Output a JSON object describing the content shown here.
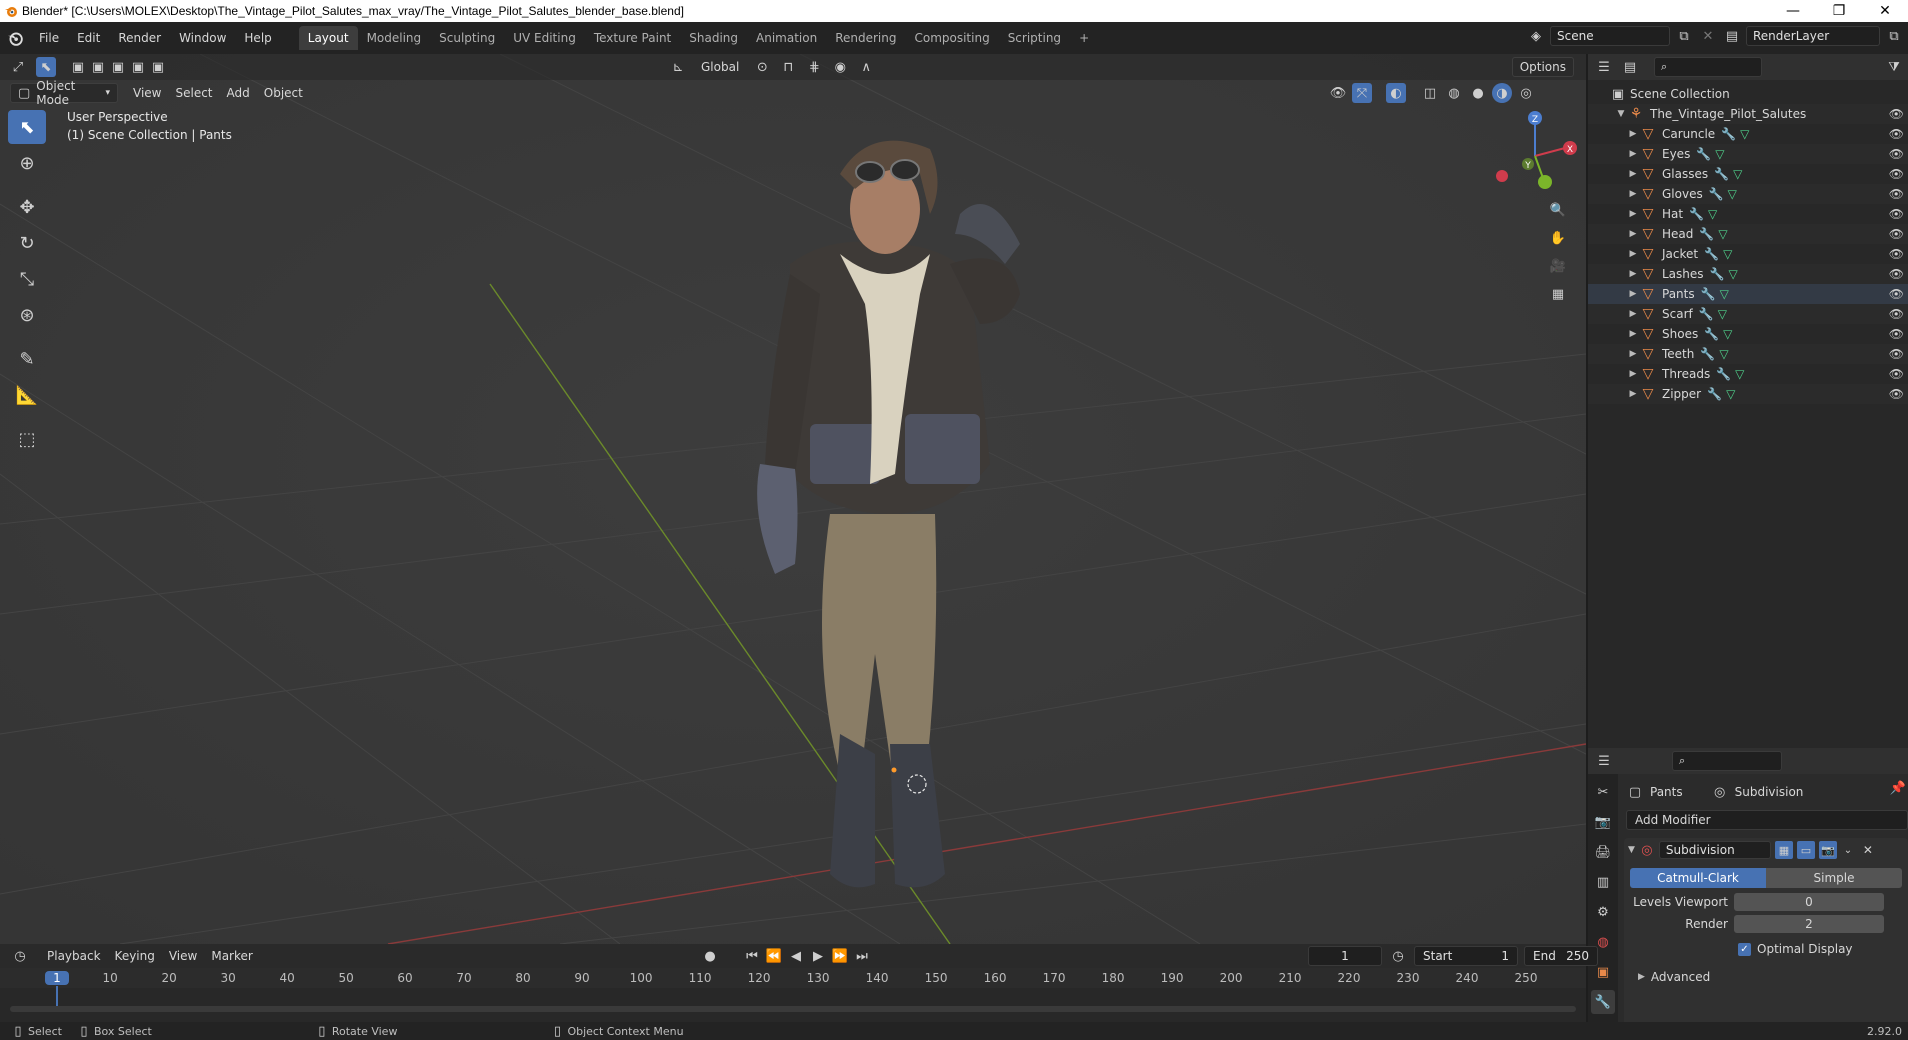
{
  "window": {
    "title": "Blender* [C:\\Users\\MOLEX\\Desktop\\The_Vintage_Pilot_Salutes_max_vray/The_Vintage_Pilot_Salutes_blender_base.blend]",
    "minimize": "—",
    "maximize": "❐",
    "close": "✕"
  },
  "menu": {
    "items": [
      "File",
      "Edit",
      "Render",
      "Window",
      "Help"
    ],
    "workspaces": [
      "Layout",
      "Modeling",
      "Sculpting",
      "UV Editing",
      "Texture Paint",
      "Shading",
      "Animation",
      "Rendering",
      "Compositing",
      "Scripting"
    ],
    "active_workspace": "Layout",
    "add_tab": "+",
    "scene_value": "Scene",
    "renderlayer_value": "RenderLayer"
  },
  "viewport": {
    "mode": "Object Mode",
    "menus": [
      "View",
      "Select",
      "Add",
      "Object"
    ],
    "transform_orientation": "Global",
    "options_label": "Options",
    "perspective_label": "User Perspective",
    "collection_label": "(1) Scene Collection | Pants",
    "gizmo": {
      "x": "X",
      "y": "Y",
      "z": "Z"
    }
  },
  "outliner": {
    "root": "Scene Collection",
    "collection": "The_Vintage_Pilot_Salutes",
    "objects": [
      "Caruncle",
      "Eyes",
      "Glasses",
      "Gloves",
      "Hat",
      "Head",
      "Jacket",
      "Lashes",
      "Pants",
      "Scarf",
      "Shoes",
      "Teeth",
      "Threads",
      "Zipper"
    ],
    "selected": "Pants"
  },
  "properties": {
    "breadcrumb_object": "Pants",
    "breadcrumb_modifier": "Subdivision",
    "add_modifier": "Add Modifier",
    "modifier_name": "Subdivision",
    "type_options": [
      "Catmull-Clark",
      "Simple"
    ],
    "active_type": "Catmull-Clark",
    "levels_viewport_label": "Levels Viewport",
    "levels_viewport_value": "0",
    "render_label": "Render",
    "render_value": "2",
    "optimal_display_label": "Optimal Display",
    "advanced_label": "Advanced",
    "version": "2.92.0"
  },
  "timeline": {
    "menus": [
      "Playback",
      "Keying",
      "View",
      "Marker"
    ],
    "current_frame": "1",
    "start_label": "Start",
    "start_value": "1",
    "end_label": "End",
    "end_value": "250",
    "ruler": [
      "1",
      "10",
      "20",
      "30",
      "40",
      "50",
      "60",
      "70",
      "80",
      "90",
      "100",
      "110",
      "120",
      "130",
      "140",
      "150",
      "160",
      "170",
      "180",
      "190",
      "200",
      "210",
      "220",
      "230",
      "240",
      "250"
    ]
  },
  "statusbar": {
    "select": "Select",
    "box_select": "Box Select",
    "rotate_view": "Rotate View",
    "context_menu": "Object Context Menu"
  }
}
